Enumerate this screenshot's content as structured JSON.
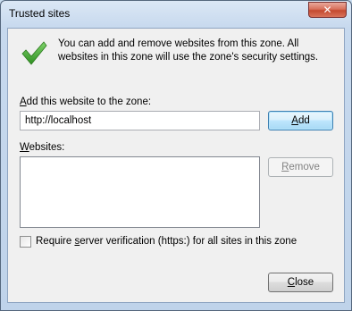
{
  "window": {
    "title": "Trusted sites",
    "close_glyph": "✕"
  },
  "info": {
    "icon": "checkmark-icon",
    "text": "You can add and remove websites from this zone. All websites in this zone will use the zone's security settings."
  },
  "add_website": {
    "label_accesskey": "A",
    "label_rest": "dd this website to the zone:",
    "input_value": "http://localhost",
    "add_button_accesskey": "A",
    "add_button_rest": "dd"
  },
  "websites": {
    "label_accesskey": "W",
    "label_rest": "ebsites:",
    "items": [],
    "remove_button_accesskey": "R",
    "remove_button_rest": "emove"
  },
  "server_verification": {
    "checked": false,
    "label_before": "Require ",
    "label_accesskey": "s",
    "label_after": "erver verification (https:) for all sites in this zone"
  },
  "footer": {
    "close_button_accesskey": "C",
    "close_button_rest": "lose"
  },
  "colors": {
    "check_green": "#3aa92c",
    "title_bar": "#c7d9ee",
    "close_red": "#c44a30"
  }
}
